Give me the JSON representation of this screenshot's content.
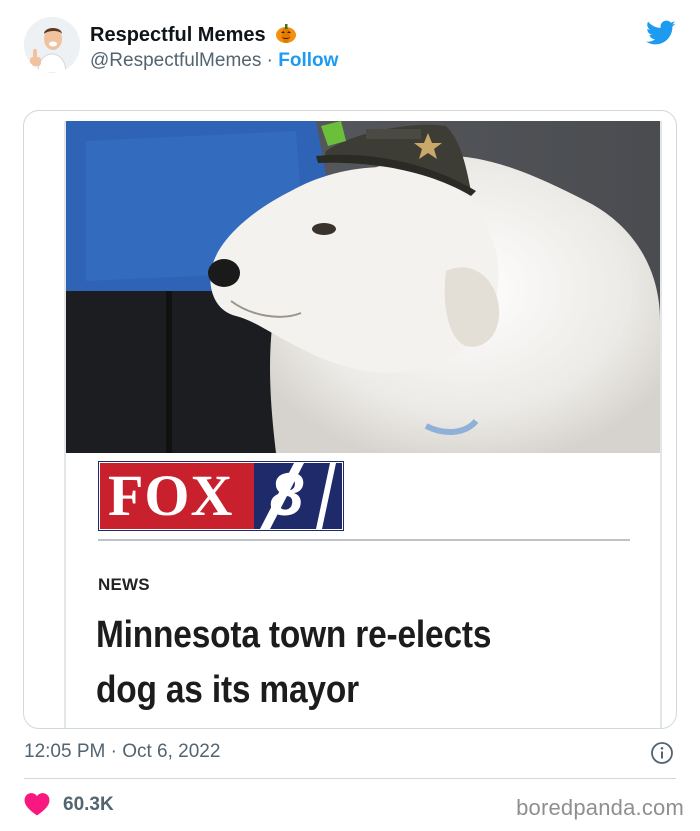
{
  "tweet": {
    "author_name": "Respectful Memes",
    "author_emoji": "pumpkin-icon",
    "handle": "@RespectfulMemes",
    "separator": " · ",
    "follow_label": "Follow",
    "timestamp": "12:05 PM · Oct 6, 2022",
    "likes": "60.3K"
  },
  "meme": {
    "channel_logo_text": "FOX",
    "channel_number": "8",
    "section": "NEWS",
    "headline_line1": "Minnesota town re-elects",
    "headline_line2": "dog as its mayor"
  },
  "watermark": "boredpanda.com",
  "colors": {
    "twitter_blue": "#1d9bf0",
    "heart": "#f91880",
    "fox_red": "#c8202c",
    "fox_navy": "#1f2a6b"
  }
}
